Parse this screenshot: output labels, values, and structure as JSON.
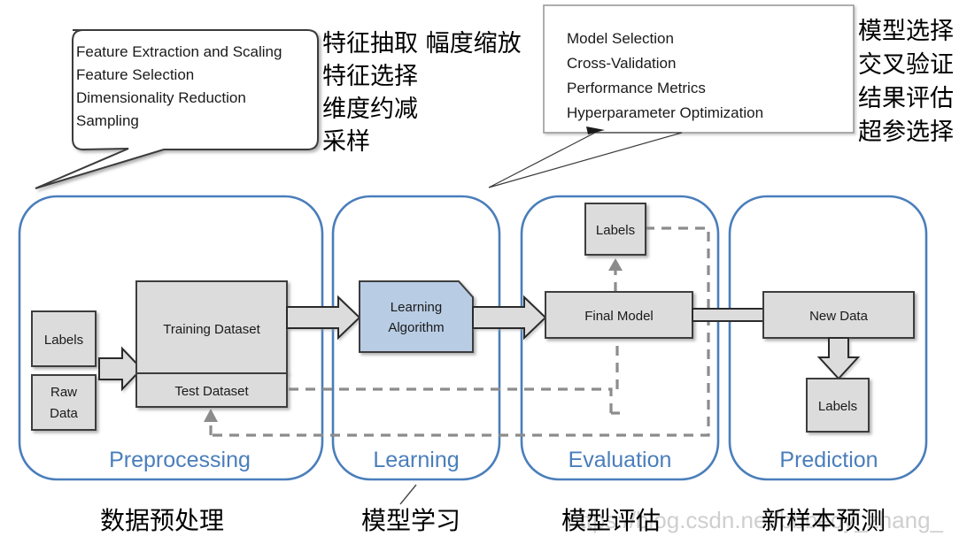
{
  "callouts": {
    "preprocessing": {
      "name": "preprocessing-callout",
      "lines": [
        "Feature Extraction and Scaling",
        "Feature Selection",
        "Dimensionality Reduction",
        "Sampling"
      ]
    },
    "preprocessing_cn": {
      "name": "preprocessing-callout-chinese",
      "lines": [
        "特征抽取 幅度缩放",
        "特征选择",
        "维度约减",
        "采样"
      ]
    },
    "evaluation": {
      "name": "evaluation-callout",
      "lines": [
        "Model Selection",
        "Cross-Validation",
        "Performance Metrics",
        "Hyperparameter Optimization"
      ]
    },
    "evaluation_cn": {
      "name": "evaluation-callout-chinese",
      "lines": [
        "模型选择",
        "交叉验证",
        "结果评估",
        "超参选择"
      ]
    }
  },
  "panels": [
    {
      "id": "preprocessing",
      "label": "Preprocessing",
      "caption_cn": "数据预处理",
      "nodes": [
        {
          "id": "labels",
          "label": "Labels"
        },
        {
          "id": "raw-data-line1",
          "label": "Raw"
        },
        {
          "id": "raw-data-line2",
          "label": "Data"
        },
        {
          "id": "training-dataset",
          "label": "Training Dataset"
        },
        {
          "id": "test-dataset",
          "label": "Test Dataset"
        }
      ]
    },
    {
      "id": "learning",
      "label": "Learning",
      "caption_cn": "模型学习",
      "nodes": [
        {
          "id": "learning-algorithm-line1",
          "label": "Learning"
        },
        {
          "id": "learning-algorithm-line2",
          "label": "Algorithm"
        }
      ]
    },
    {
      "id": "evaluation",
      "label": "Evaluation",
      "caption_cn": "模型评估",
      "nodes": [
        {
          "id": "eval-labels",
          "label": "Labels"
        },
        {
          "id": "final-model",
          "label": "Final Model"
        }
      ]
    },
    {
      "id": "prediction",
      "label": "Prediction",
      "caption_cn": "新样本预测",
      "nodes": [
        {
          "id": "new-data",
          "label": "New Data"
        },
        {
          "id": "prediction-labels",
          "label": "Labels"
        }
      ]
    }
  ],
  "watermark": {
    "text": "https://blog.csdn.net/bbbeoy_zhang_"
  },
  "colors": {
    "panel_border": "#4a7ebb",
    "panel_label": "#4a7ebb",
    "node_fill": "#dcdcdc",
    "algorithm_fill": "#b8cce4",
    "node_stroke": "#3d3d3d",
    "dashed_line": "#8c8c8c"
  }
}
